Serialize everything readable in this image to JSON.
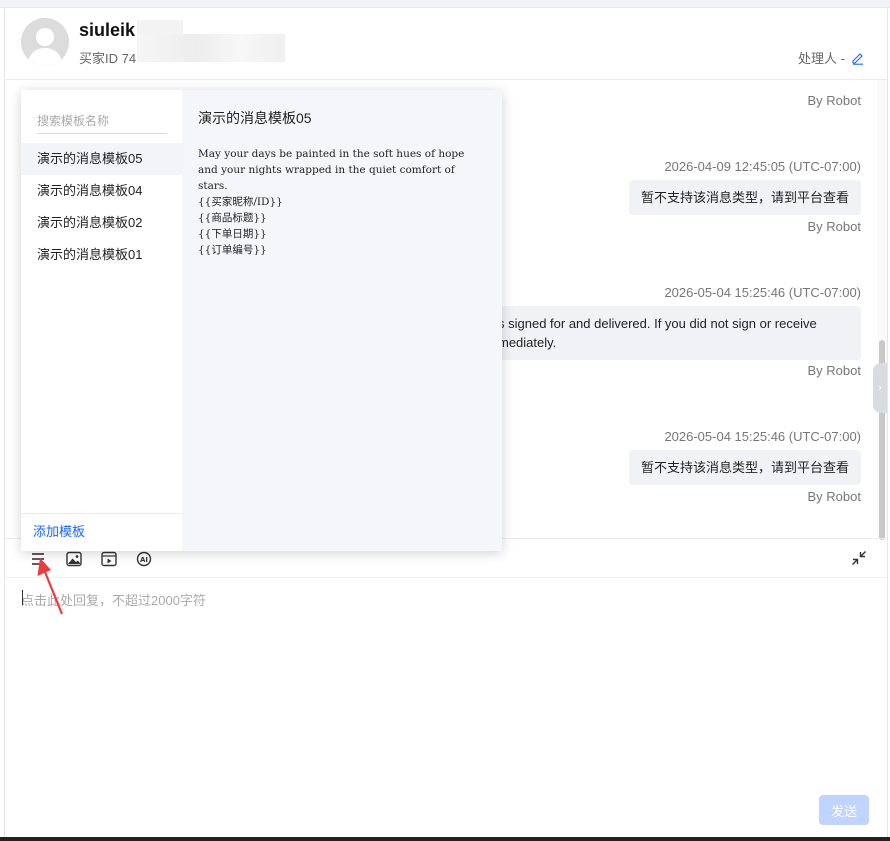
{
  "header": {
    "buyer_name": "siuleik",
    "buyer_id": "买家ID 74",
    "handler_label": "处理人  -"
  },
  "chat": {
    "messages": [
      {
        "robot": "By Robot"
      },
      {
        "timestamp": "2026-04-09 12:45:05 (UTC-07:00)",
        "text": "暂不支持该消息类型，请到平台查看",
        "robot": "By Robot"
      },
      {
        "timestamp": "2026-05-04 15:25:46 (UTC-07:00)",
        "line1": "s signed for and delivered. If you did not sign or receive",
        "line2": "mediately.",
        "robot": "By Robot"
      },
      {
        "timestamp": "2026-05-04 15:25:46 (UTC-07:00)",
        "text": "暂不支持该消息类型，请到平台查看",
        "robot": "By Robot"
      }
    ]
  },
  "templates": {
    "search_placeholder": "搜索模板名称",
    "items": [
      "演示的消息模板05",
      "演示的消息模板04",
      "演示的消息模板02",
      "演示的消息模板01"
    ],
    "active_index": 0,
    "add_label": "添加模板",
    "preview": {
      "title": "演示的消息模板05",
      "body": "May your days be painted in the soft hues of hope and your nights wrapped in the quiet comfort of stars.\n{{买家昵称/ID}}\n{{商品标题}}\n{{下单日期}}\n{{订单编号}}"
    }
  },
  "composer": {
    "placeholder": "点击此处回复，不超过2000字符",
    "send_label": "发送"
  },
  "icons": {
    "toolbar": [
      "template-list-icon",
      "image-icon",
      "video-icon",
      "ai-icon"
    ],
    "collapse": "collapse-icon",
    "edit": "edit-icon"
  },
  "colors": {
    "accent": "#1966ff",
    "send_disabled": "#bfd4ff",
    "bubble": "#f0f2f5",
    "annotation_arrow": "#ee3a3a"
  }
}
